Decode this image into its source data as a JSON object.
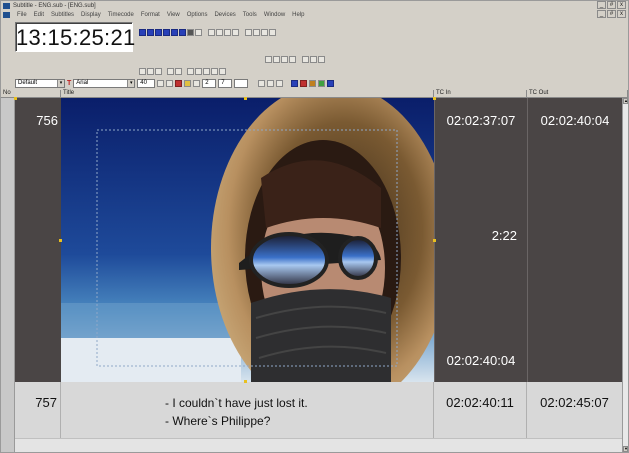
{
  "window": {
    "title": "Subtitle - ENG.sub - [ENG.sub]",
    "controls": [
      "_",
      "#",
      "x"
    ]
  },
  "menu": [
    "File",
    "Edit",
    "Subtitles",
    "Display",
    "Timecode",
    "Format",
    "View",
    "Options",
    "Devices",
    "Tools",
    "Window",
    "Help"
  ],
  "timecode": "13:15:25:21",
  "format_bar": {
    "style": "Default",
    "font": "Arial",
    "size": "40",
    "spacing": "2",
    "line": "7"
  },
  "columns": {
    "no": "No",
    "title": "Title",
    "tc_in": "TC In",
    "tc_out": "TC Out"
  },
  "rows": [
    {
      "no": "756",
      "tc_in": "02:02:37:07",
      "duration": "2:22",
      "tc_end": "02:02:40:04",
      "tc_out": "02:02:40:04",
      "image": "hooded-face-sunglasses-image"
    },
    {
      "no": "757",
      "line1": "- I couldn`t have just lost it.",
      "line2": "- Where`s Philippe?",
      "tc_in": "02:02:40:11",
      "tc_out": "02:02:45:07"
    }
  ],
  "colors": {
    "frame": "#d4d0c8",
    "selected_cell": "#4a4545",
    "row_bg": "#d8d8d8",
    "toolbar_blue": "#2840b8"
  }
}
